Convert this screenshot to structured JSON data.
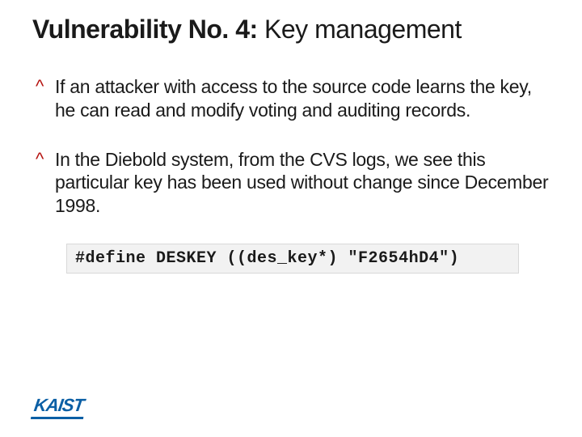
{
  "title": {
    "bold": "Vulnerability No. 4:",
    "rest": " Key management"
  },
  "bullets": [
    "If an attacker with access to the source code learns the key, he can read and modify voting and auditing records.",
    "In the Diebold system, from the CVS logs, we see this particular key has been used without change since December 1998."
  ],
  "code": "#define DESKEY ((des_key*) \"F2654hD4\")",
  "logo": "KAIST"
}
